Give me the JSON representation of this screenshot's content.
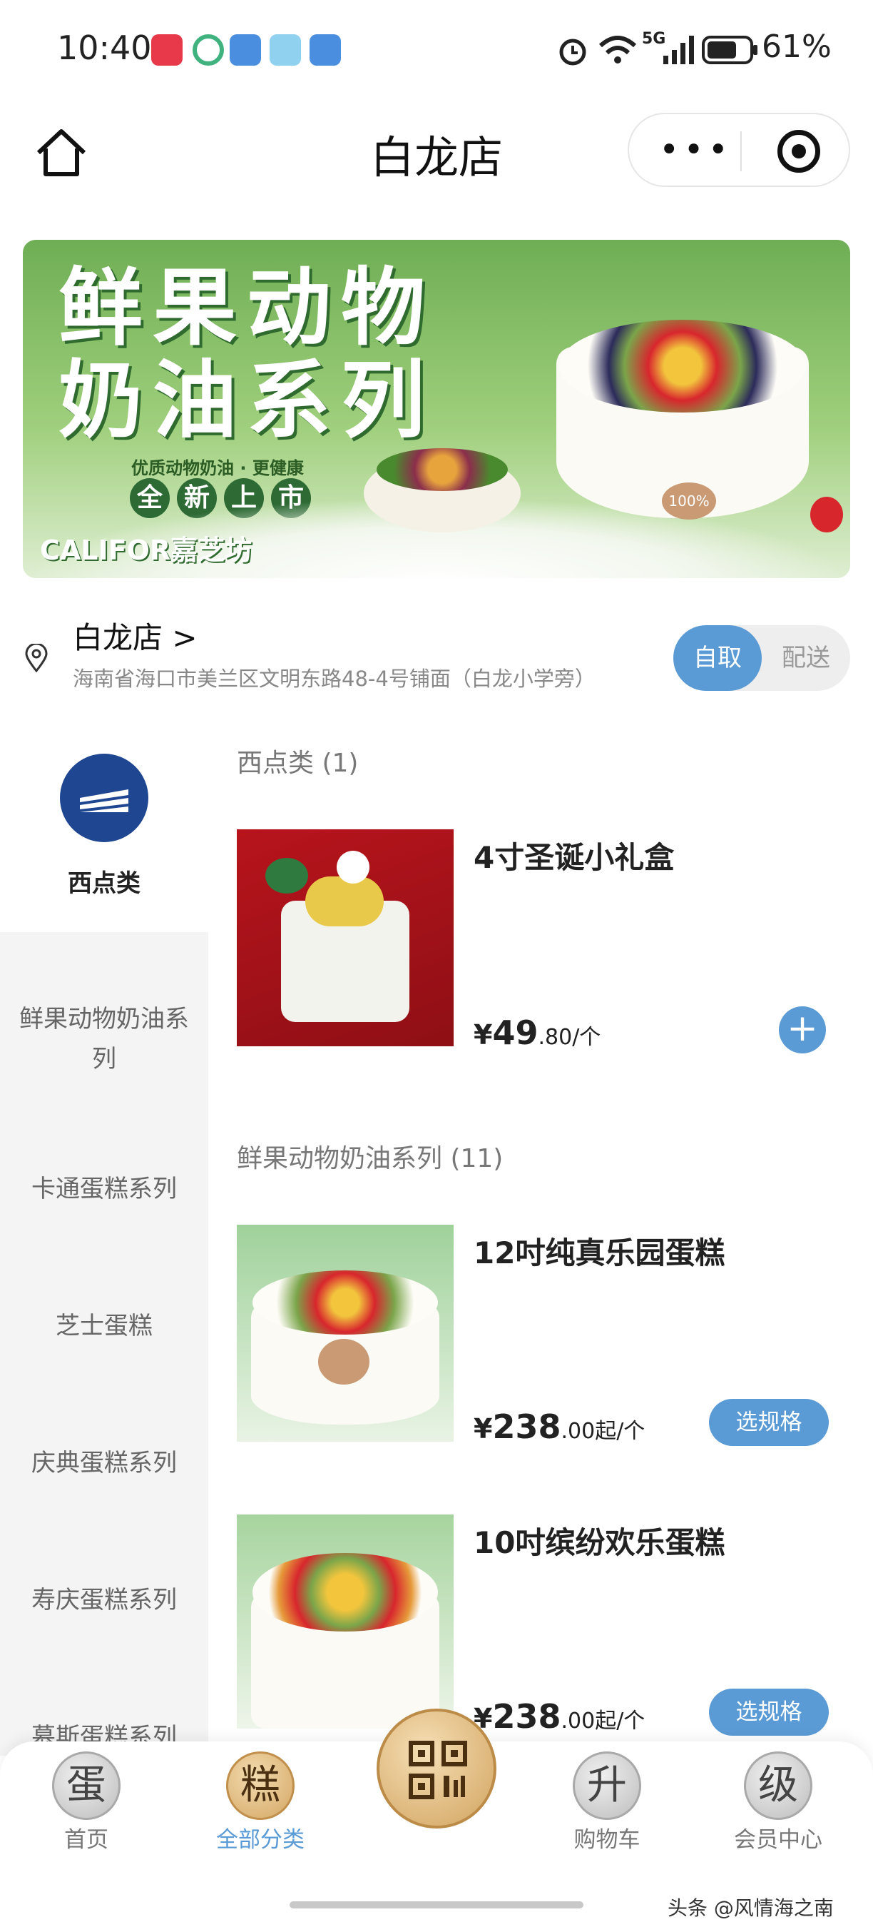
{
  "status_bar": {
    "time": "10:40",
    "network": "5G",
    "battery": "61%"
  },
  "header": {
    "title": "白龙店"
  },
  "banner": {
    "title_line1": "鲜果动物",
    "title_line2": "奶油系列",
    "tagline": "优质动物奶油 · 更健康",
    "pill_chars": [
      "全",
      "新",
      "上",
      "市"
    ],
    "brand": "CALIFOR嘉芝坊",
    "cake_badge": "100%"
  },
  "store": {
    "name": "白龙店 >",
    "address": "海南省海口市美兰区文明东路48-4号铺面（白龙小学旁）",
    "mode_pickup": "自取",
    "mode_delivery": "配送"
  },
  "sidebar": {
    "items": [
      {
        "label": "西点类"
      },
      {
        "label": "鲜果动物奶油系列"
      },
      {
        "label": "卡通蛋糕系列"
      },
      {
        "label": "芝士蛋糕"
      },
      {
        "label": "庆典蛋糕系列"
      },
      {
        "label": "寿庆蛋糕系列"
      },
      {
        "label": "慕斯蛋糕系列"
      }
    ]
  },
  "sections": [
    {
      "title": "西点类 (1)",
      "products": [
        {
          "name": "4寸圣诞小礼盒",
          "currency": "¥",
          "price_int": "49",
          "price_dec": ".80",
          "unit": "/个",
          "action": "+"
        }
      ]
    },
    {
      "title": "鲜果动物奶油系列 (11)",
      "products": [
        {
          "name": "12吋纯真乐园蛋糕",
          "currency": "¥",
          "price_int": "238",
          "price_dec": ".00起",
          "unit": "/个",
          "action": "选规格"
        },
        {
          "name": "10吋缤纷欢乐蛋糕",
          "currency": "¥",
          "price_int": "238",
          "price_dec": ".00起",
          "unit": "/个",
          "action": "选规格"
        }
      ]
    }
  ],
  "tabbar": {
    "tabs": [
      {
        "seal": "蛋",
        "label": "首页"
      },
      {
        "seal": "糕",
        "label": "全部分类"
      },
      {
        "seal": "升",
        "label": "购物车"
      },
      {
        "seal": "级",
        "label": "会员中心"
      }
    ]
  },
  "watermark": "头条 @风情海之南",
  "colors": {
    "accent": "#5b9bd5",
    "category_icon": "#1f4690",
    "banner_green": "#6fae54"
  }
}
